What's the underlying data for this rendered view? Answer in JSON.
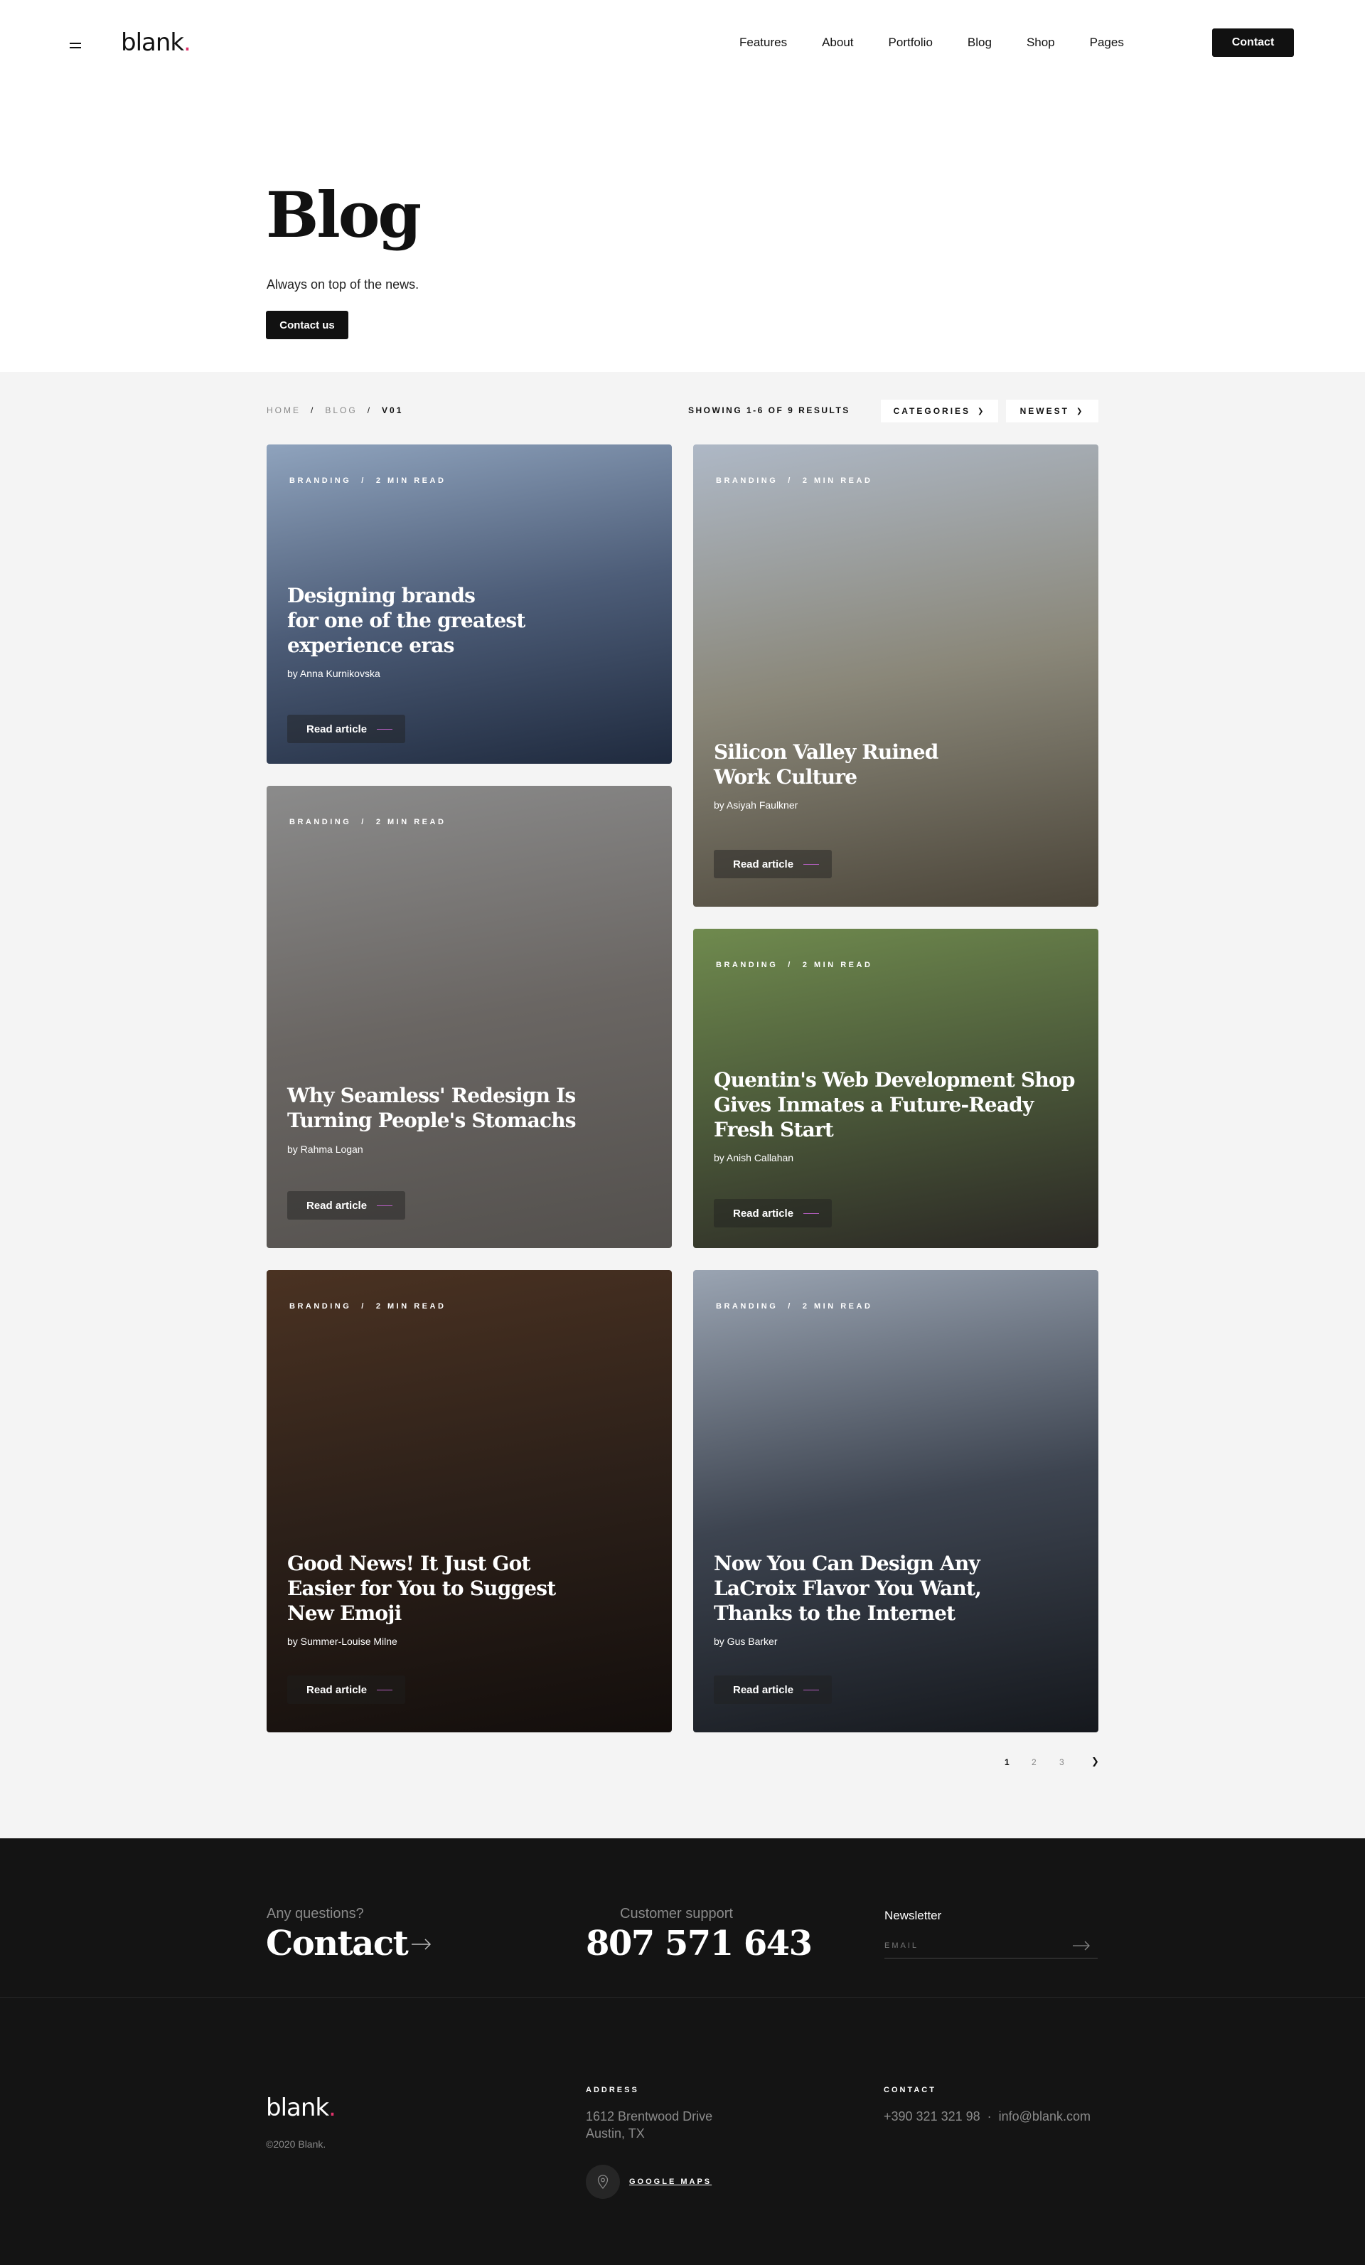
{
  "header": {
    "logo": "blank",
    "logo_dot": ".",
    "nav": [
      "Features",
      "About",
      "Portfolio",
      "Blog",
      "Shop",
      "Pages"
    ],
    "contact_label": "Contact"
  },
  "hero": {
    "title": "Blog",
    "subtitle": "Always on top of the news.",
    "button_label": "Contact us"
  },
  "breadcrumb": {
    "home": "HOME",
    "blog": "BLOG",
    "current": "V01",
    "separator": "/"
  },
  "toolbar": {
    "results": "SHOWING 1-6 OF 9 RESULTS",
    "categories": "CATEGORIES",
    "sort": "NEWEST"
  },
  "cards": [
    {
      "category": "BRANDING",
      "read_time": "2 MIN READ",
      "title_lines": [
        "Designing brands",
        "for one of the greatest",
        "experience eras"
      ],
      "author": "by Anna Kurnikovska",
      "button": "Read article",
      "image_colors": [
        "#8fa3bd",
        "#4d5d78",
        "#1f2a3e"
      ]
    },
    {
      "category": "BRANDING",
      "read_time": "2 MIN READ",
      "title_lines": [
        "Silicon Valley Ruined",
        "Work Culture"
      ],
      "author": "by Asiyah Faulkner",
      "button": "Read article",
      "image_colors": [
        "#aeb8c6",
        "#8a8779",
        "#4a4438"
      ]
    },
    {
      "category": "BRANDING",
      "read_time": "2 MIN READ",
      "title_lines": [
        "Why Seamless' Redesign Is",
        "Turning People's Stomachs"
      ],
      "author": "by Rahma Logan",
      "button": "Read article",
      "image_colors": [
        "#8b8b8b",
        "#6a6663",
        "#53504d"
      ]
    },
    {
      "category": "BRANDING",
      "read_time": "2 MIN READ",
      "title_lines": [
        "Quentin's Web Development Shop",
        "Gives Inmates a Future-Ready",
        "Fresh Start"
      ],
      "author": "by Anish Callahan",
      "button": "Read article",
      "image_colors": [
        "#6f8a4e",
        "#4c5a3a",
        "#2a2724"
      ]
    },
    {
      "category": "BRANDING",
      "read_time": "2 MIN READ",
      "title_lines": [
        "Good News! It Just Got",
        "Easier for You to Suggest",
        "New Emoji"
      ],
      "author": "by Summer-Louise Milne",
      "button": "Read article",
      "image_colors": [
        "#4a3222",
        "#2c2019",
        "#130e0c"
      ]
    },
    {
      "category": "BRANDING",
      "read_time": "2 MIN READ",
      "title_lines": [
        "Now You Can Design Any",
        "LaCroix Flavor You Want,",
        "Thanks to the Internet"
      ],
      "author": "by Gus Barker",
      "button": "Read article",
      "image_colors": [
        "#9aa4b2",
        "#3d4450",
        "#15181d"
      ]
    }
  ],
  "pagination": {
    "pages": [
      "1",
      "2",
      "3"
    ],
    "active": "1"
  },
  "footer": {
    "question": "Any questions?",
    "contact": "Contact",
    "support_label": "Customer support",
    "phone": "807 571 643",
    "newsletter": "Newsletter",
    "email_placeholder": "EMAIL",
    "logo": "blank",
    "logo_dot": ".",
    "copyright": "©2020 Blank.",
    "address_heading": "ADDRESS",
    "address_line1": "1612  Brentwood Drive",
    "address_line2": "Austin, TX",
    "maps": "GOOGLE MAPS",
    "contact_heading": "CONTACT",
    "contact_phone": "+390 321 321 98",
    "contact_sep": "·",
    "contact_email": "info@blank.com"
  },
  "colors": {
    "accent": "#e0336b",
    "dark": "#111111",
    "footer_bg": "#141414",
    "section_bg": "#f4f4f4",
    "button_line": "#b65fc2"
  }
}
